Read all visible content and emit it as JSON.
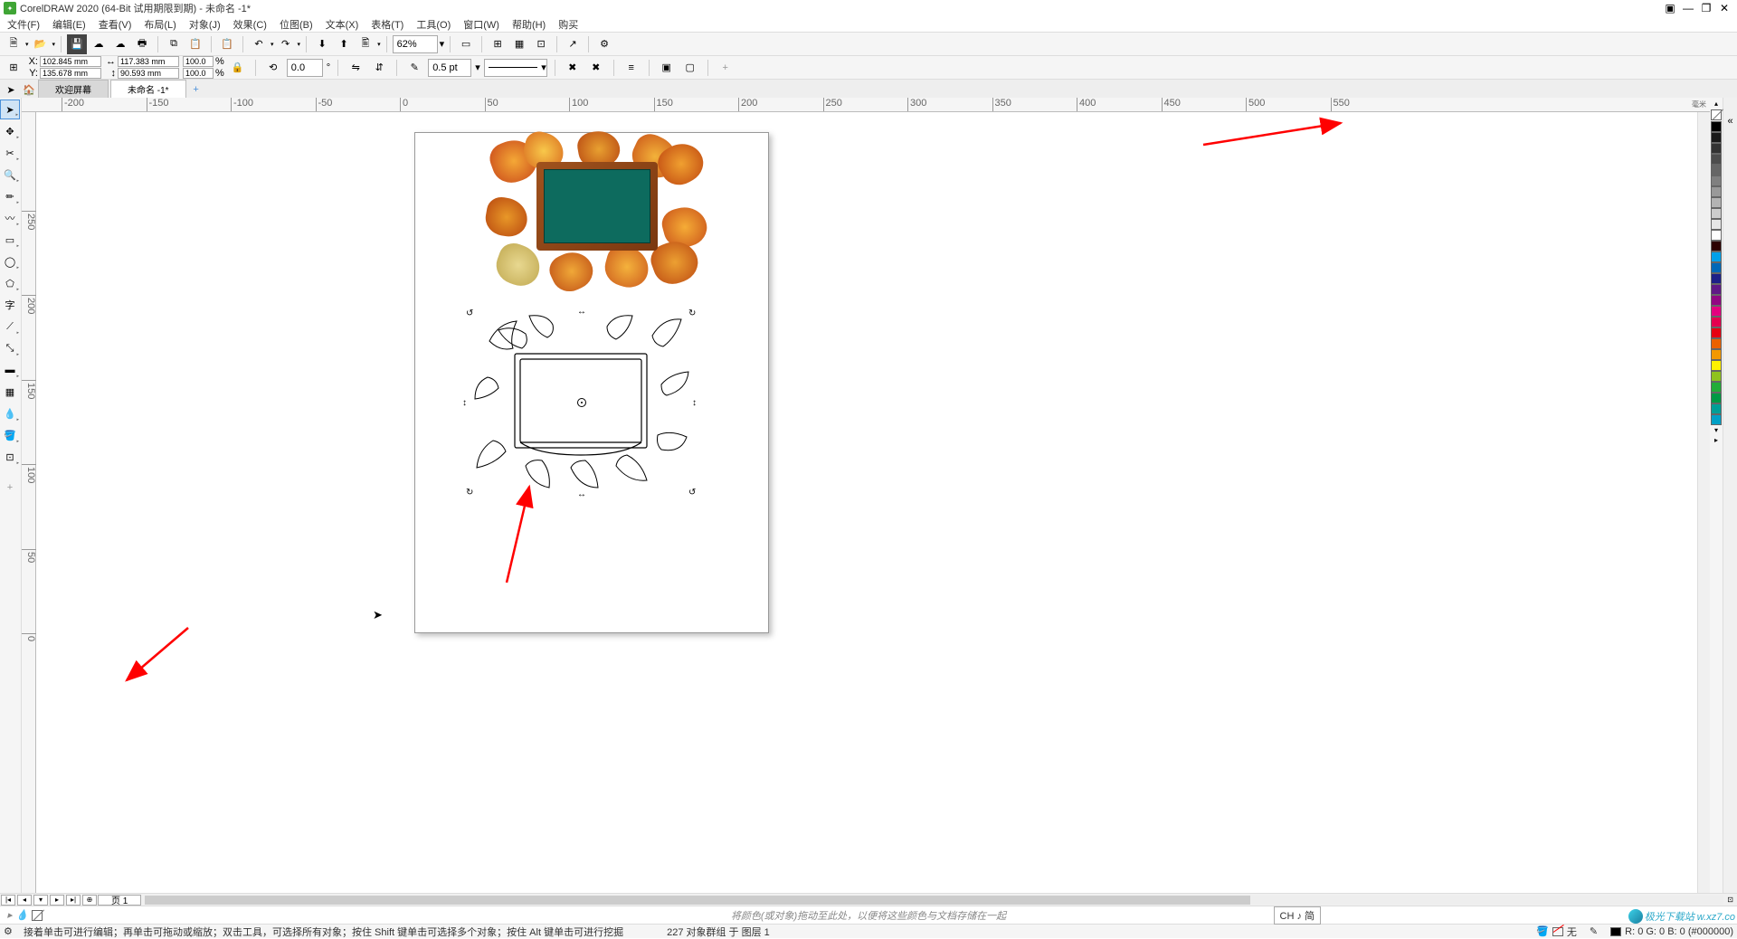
{
  "title": "CorelDRAW 2020 (64-Bit 试用期限到期) - 未命名 -1*",
  "menu": [
    "文件(F)",
    "编辑(E)",
    "查看(V)",
    "布局(L)",
    "对象(J)",
    "效果(C)",
    "位图(B)",
    "文本(X)",
    "表格(T)",
    "工具(O)",
    "窗口(W)",
    "帮助(H)",
    "购买"
  ],
  "zoom": "62%",
  "coords": {
    "x_label": "X:",
    "y_label": "Y:",
    "x": "102.845 mm",
    "y": "135.678 mm"
  },
  "size": {
    "w_icon": "↔",
    "h_icon": "↕",
    "w": "117.383 mm",
    "h": "90.593 mm"
  },
  "scale": {
    "sx": "100.0",
    "sy": "100.0",
    "unit": "%"
  },
  "rotation": "0.0",
  "outline_width": "0.5 pt",
  "tabs": {
    "welcome": "欢迎屏幕",
    "doc": "未命名 -1*"
  },
  "ruler_h": {
    "unit": "毫米",
    "ticks": [
      "-200",
      "-150",
      "-100",
      "-50",
      "0",
      "50",
      "100",
      "150",
      "200",
      "250",
      "300",
      "350",
      "400",
      "450",
      "500",
      "550"
    ]
  },
  "ruler_v": {
    "ticks": [
      "250",
      "200",
      "150",
      "100",
      "50",
      "0"
    ]
  },
  "page_nav": {
    "page": "页 1"
  },
  "color_hint_row": {
    "mid": "将颜色(或对象)拖动至此处，以便将这些颜色与文档存储在一起",
    "ime": "CH ♪ 简"
  },
  "status": {
    "hint": "接着单击可进行编辑；再单击可拖动或缩放；双击工具，可选择所有对象；按住 Shift 键单击可选择多个对象；按住 Alt 键单击可进行挖掘",
    "selection": "227 对象群组 于 图层 1",
    "fill_label": "无",
    "rgb": "R: 0 G: 0 B: 0 (#000000)"
  },
  "palette_colors": [
    "#000000",
    "#1a1a1a",
    "#333333",
    "#4d4d4d",
    "#666666",
    "#808080",
    "#999999",
    "#b3b3b3",
    "#cccccc",
    "#e6e6e6",
    "#ffffff",
    "#2b0000",
    "#00a0e9",
    "#0068b7",
    "#1d2088",
    "#601986",
    "#920783",
    "#e4007f",
    "#e5004f",
    "#e60012",
    "#eb6100",
    "#f39800",
    "#fff100",
    "#8fc31f",
    "#22ac38",
    "#009944",
    "#009e96",
    "#00a0c6"
  ],
  "watermark": "极光下载站 w.xz7.co"
}
